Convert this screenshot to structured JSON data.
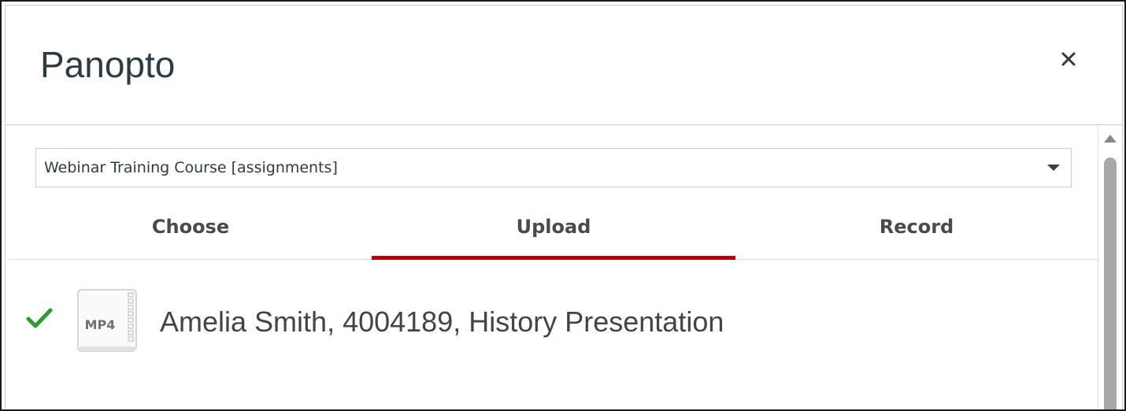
{
  "dialog": {
    "title": "Panopto",
    "close_label": "×"
  },
  "folder_select": {
    "selected": "Webinar Training Course [assignments]"
  },
  "tabs": [
    {
      "label": "Choose",
      "active": false
    },
    {
      "label": "Upload",
      "active": true
    },
    {
      "label": "Record",
      "active": false
    }
  ],
  "upload_item": {
    "status_icon": "check-icon",
    "file_type": "MP4",
    "name": "Amelia Smith, 4004189, History Presentation"
  },
  "colors": {
    "active_tab_underline": "#b8000d",
    "success_check": "#2d9a34",
    "title_text": "#2d3b45"
  }
}
